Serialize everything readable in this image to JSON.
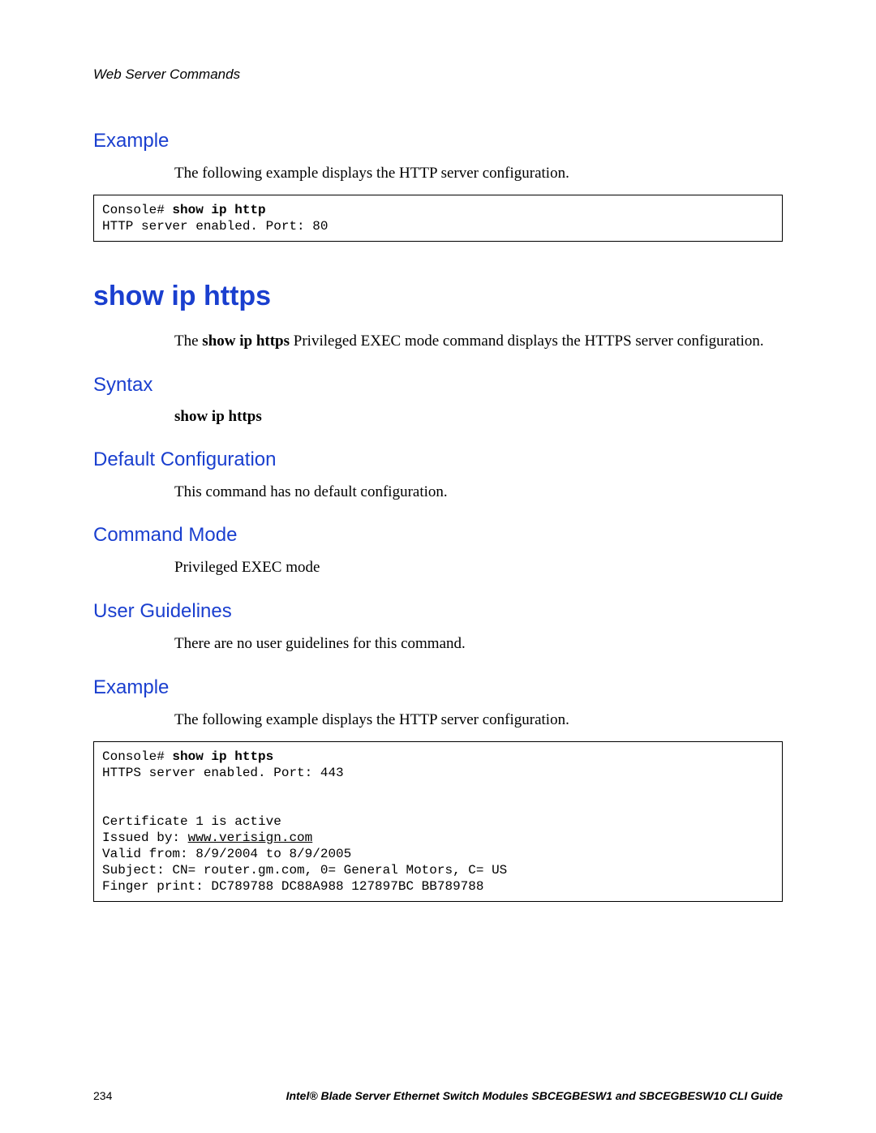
{
  "header": {
    "running_title": "Web Server Commands"
  },
  "section1": {
    "heading": "Example",
    "para": "The following example displays the HTTP server configuration.",
    "code_prompt": "Console# ",
    "code_cmd": "show ip http",
    "code_output": "HTTP server enabled. Port: 80"
  },
  "command_title": "show ip https",
  "intro": {
    "prefix": "The ",
    "cmd": "show ip https",
    "suffix": " Privileged EXEC mode command displays the HTTPS server configuration."
  },
  "syntax": {
    "heading": "Syntax",
    "text": "show ip https"
  },
  "default_cfg": {
    "heading": "Default Configuration",
    "text": "This command has no default configuration."
  },
  "cmd_mode": {
    "heading": "Command Mode",
    "text": "Privileged EXEC mode"
  },
  "user_guidelines": {
    "heading": "User Guidelines",
    "text": "There are no user guidelines for this command."
  },
  "example2": {
    "heading": "Example",
    "para": "The following example displays the HTTP server configuration.",
    "code_prompt": "Console# ",
    "code_cmd": "show ip https",
    "line1": "HTTPS server enabled. Port: 443",
    "blank": "",
    "line3": "Certificate 1 is active",
    "line4a": "Issued by: ",
    "line4b": "www.verisign.com",
    "line5": "Valid from: 8/9/2004 to 8/9/2005",
    "line6": "Subject: CN= router.gm.com, 0= General Motors, C= US",
    "line7": "Finger print: DC789788 DC88A988 127897BC BB789788"
  },
  "footer": {
    "page_number": "234",
    "doc_title": "Intel® Blade Server Ethernet Switch Modules SBCEGBESW1 and SBCEGBESW10 CLI Guide"
  }
}
